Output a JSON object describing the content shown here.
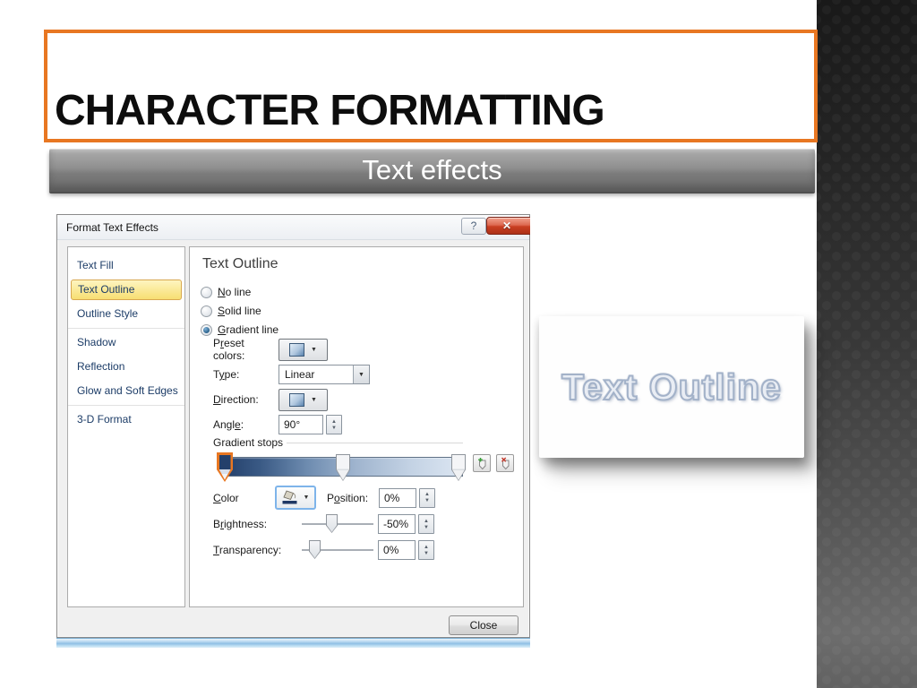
{
  "slide": {
    "title": "CHARACTER FORMATTING",
    "subtitle": "Text effects"
  },
  "icons": {
    "dropdown": "▼",
    "spin_up": "▲",
    "spin_down": "▼",
    "help": "?",
    "close": "✕"
  },
  "colors": {
    "accent_orange": "#E87722",
    "nav_selected_bg": "#F7DE72",
    "gradient_stop_dark": "#24406B",
    "gradient_stop_light": "#DCE6F2",
    "close_button_red": "#C93F22",
    "blue_strip": "#8FBFE4",
    "side_texture_dark": "#1E1E1E",
    "sample_text": "#A3B2C9"
  },
  "dialog": {
    "title": "Format Text Effects",
    "close_label": "Close",
    "nav": [
      {
        "label": "Text Fill"
      },
      {
        "label": "Text Outline",
        "selected": true
      },
      {
        "label": "Outline Style"
      },
      {
        "label": "Shadow"
      },
      {
        "label": "Reflection"
      },
      {
        "label": "Glow and Soft Edges"
      },
      {
        "label": "3-D Format"
      }
    ],
    "panel": {
      "heading": "Text Outline",
      "radios": [
        {
          "pre": "",
          "u": "N",
          "post": "o line",
          "selected": false
        },
        {
          "pre": "",
          "u": "S",
          "post": "olid line",
          "selected": false
        },
        {
          "pre": "",
          "u": "G",
          "post": "radient line",
          "selected": true
        }
      ],
      "rows": {
        "preset": {
          "pre": "P",
          "u": "r",
          "post": "eset colors:"
        },
        "type": {
          "pre": "T",
          "u": "y",
          "post": "pe:",
          "value": "Linear"
        },
        "direction": {
          "pre": "",
          "u": "D",
          "post": "irection:"
        },
        "angle": {
          "pre": "Angl",
          "u": "e",
          "post": ":",
          "value": "90°"
        }
      },
      "stops_label": "Gradient stops",
      "gradient_bar": {
        "start_color": "#24406B",
        "end_color": "#DCE6F2",
        "stops": [
          {
            "position": "0%",
            "selected": true
          },
          {
            "position": "50%",
            "selected": false
          },
          {
            "position": "100%",
            "selected": false
          }
        ]
      },
      "color": {
        "pre": "",
        "u": "C",
        "post": "olor"
      },
      "position": {
        "pre": "P",
        "u": "o",
        "post": "sition:",
        "value": "0%"
      },
      "brightness": {
        "pre": "B",
        "u": "r",
        "post": "ightness:",
        "value": "-50%"
      },
      "transparency": {
        "pre": "",
        "u": "T",
        "post": "ransparency:",
        "value": "0%"
      }
    }
  },
  "sample": {
    "text": "Text Outline"
  }
}
